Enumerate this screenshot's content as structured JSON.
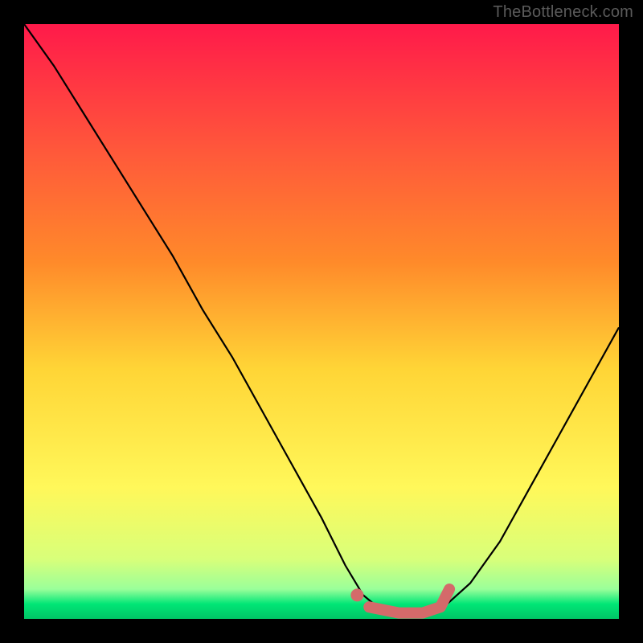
{
  "watermark": {
    "text": "TheBottleneck.com"
  },
  "chart_data": {
    "type": "line",
    "title": "",
    "xlabel": "",
    "ylabel": "",
    "xlim": [
      0,
      100
    ],
    "ylim": [
      0,
      100
    ],
    "grid": false,
    "legend": false,
    "background_gradient": {
      "top": "#ff1a4a",
      "mid_upper": "#ff8a2a",
      "mid": "#ffd536",
      "mid_lower": "#fff85a",
      "near_bottom": "#d8ff7a",
      "bottom_band": "#00e676",
      "very_bottom": "#00c566"
    },
    "series": [
      {
        "name": "bottleneck-curve",
        "x": [
          0,
          5,
          10,
          15,
          20,
          25,
          30,
          35,
          40,
          45,
          50,
          54,
          57,
          60,
          63,
          66,
          70,
          75,
          80,
          85,
          90,
          95,
          100
        ],
        "y": [
          100,
          93,
          85,
          77,
          69,
          61,
          52,
          44,
          35,
          26,
          17,
          9,
          4,
          1.5,
          0.8,
          0.8,
          1.5,
          6,
          13,
          22,
          31,
          40,
          49
        ],
        "color": "#000000"
      }
    ],
    "highlight": {
      "name": "optimal-range",
      "color": "#d46a6a",
      "segments": [
        {
          "kind": "dot",
          "x": 56,
          "y": 4
        },
        {
          "kind": "path",
          "x": [
            58,
            63,
            67,
            70,
            71.5
          ],
          "y": [
            2,
            1,
            1,
            2,
            5
          ]
        }
      ]
    }
  }
}
